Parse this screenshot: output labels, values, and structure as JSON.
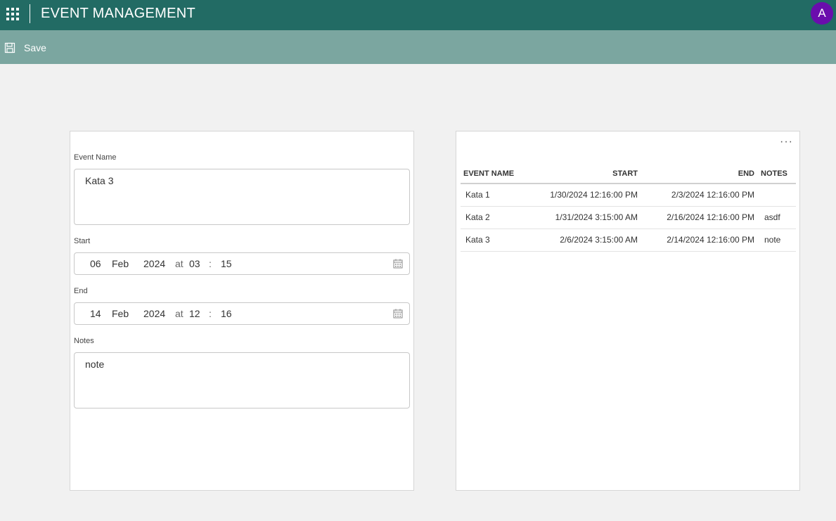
{
  "header": {
    "app_title": "EVENT MANAGEMENT",
    "avatar_initial": "A",
    "avatar_color": "#6a0dad",
    "brand_color": "#226b64"
  },
  "command_bar": {
    "save_label": "Save",
    "save_icon": "floppy-disk-icon"
  },
  "form": {
    "event_name_label": "Event Name",
    "event_name_value": "Kata 3",
    "start_label": "Start",
    "start": {
      "day": "06",
      "month": "Feb",
      "year": "2024",
      "at": "at",
      "hour": "03",
      "sep": ":",
      "minute": "15"
    },
    "end_label": "End",
    "end": {
      "day": "14",
      "month": "Feb",
      "year": "2024",
      "at": "at",
      "hour": "12",
      "sep": ":",
      "minute": "16"
    },
    "notes_label": "Notes",
    "notes_value": "note"
  },
  "grid": {
    "more_label": "···",
    "columns": [
      "EVENT NAME",
      "START",
      "END",
      "NOTES"
    ],
    "rows": [
      {
        "name": "Kata 1",
        "start": "1/30/2024 12:16:00 PM",
        "end": "2/3/2024 12:16:00 PM",
        "notes": ""
      },
      {
        "name": "Kata 2",
        "start": "1/31/2024 3:15:00 AM",
        "end": "2/16/2024 12:16:00 PM",
        "notes": "asdf"
      },
      {
        "name": "Kata 3",
        "start": "2/6/2024 3:15:00 AM",
        "end": "2/14/2024 12:16:00 PM",
        "notes": "note"
      }
    ]
  }
}
